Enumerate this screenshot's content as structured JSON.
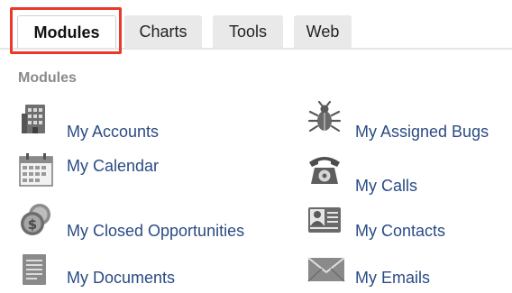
{
  "tabs": [
    {
      "label": "Modules",
      "active": true
    },
    {
      "label": "Charts",
      "active": false
    },
    {
      "label": "Tools",
      "active": false
    },
    {
      "label": "Web",
      "active": false
    }
  ],
  "highlight_color": "#e8392a",
  "link_color": "#2a4b85",
  "section": {
    "title": "Modules"
  },
  "items": [
    {
      "label": "My Accounts",
      "icon": "building-icon"
    },
    {
      "label": "My Assigned Bugs",
      "icon": "bug-icon"
    },
    {
      "label": "My Calendar",
      "icon": "calendar-icon"
    },
    {
      "label": "My Calls",
      "icon": "telephone-icon"
    },
    {
      "label": "My Closed Opportunities",
      "icon": "coins-icon"
    },
    {
      "label": "My Contacts",
      "icon": "contact-card-icon"
    },
    {
      "label": "My Documents",
      "icon": "document-icon"
    },
    {
      "label": "My Emails",
      "icon": "envelope-icon"
    }
  ]
}
